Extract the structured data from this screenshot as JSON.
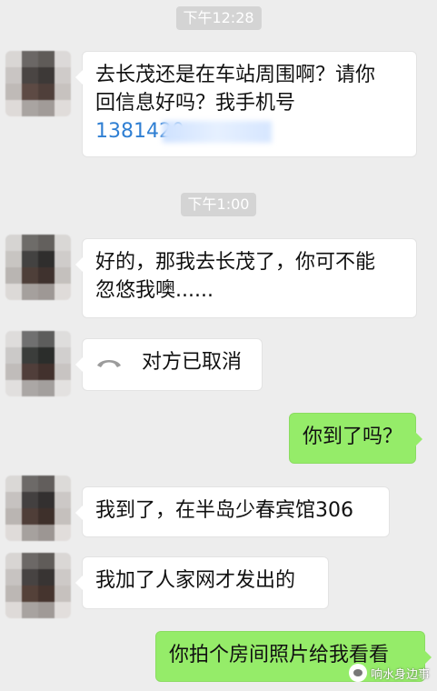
{
  "timestamps": [
    "下午12:28",
    "下午1:00"
  ],
  "messages": {
    "m1": {
      "line1": "去长茂还是在车站周围啊？请你",
      "line2": "回信息好吗？我手机号",
      "phone_visible": "1381420"
    },
    "m2": {
      "line1": "好的，那我去长茂了，你可不能",
      "line2": "忽悠我噢......"
    },
    "m3": {
      "text": "对方已取消",
      "icon": "hangup-phone-icon"
    },
    "m4": {
      "text": "你到了吗？"
    },
    "m5": {
      "text": "我到了，在半岛少春宾馆306"
    },
    "m6": {
      "text": "我加了人家网才发出的"
    },
    "m7": {
      "text": "你拍个房间照片给我看看"
    }
  },
  "watermark": {
    "text": "响水身边事"
  },
  "colors": {
    "sent_bubble": "#95ec69",
    "received_bubble": "#ffffff",
    "background": "#ededed",
    "link": "#2f7fd3"
  }
}
